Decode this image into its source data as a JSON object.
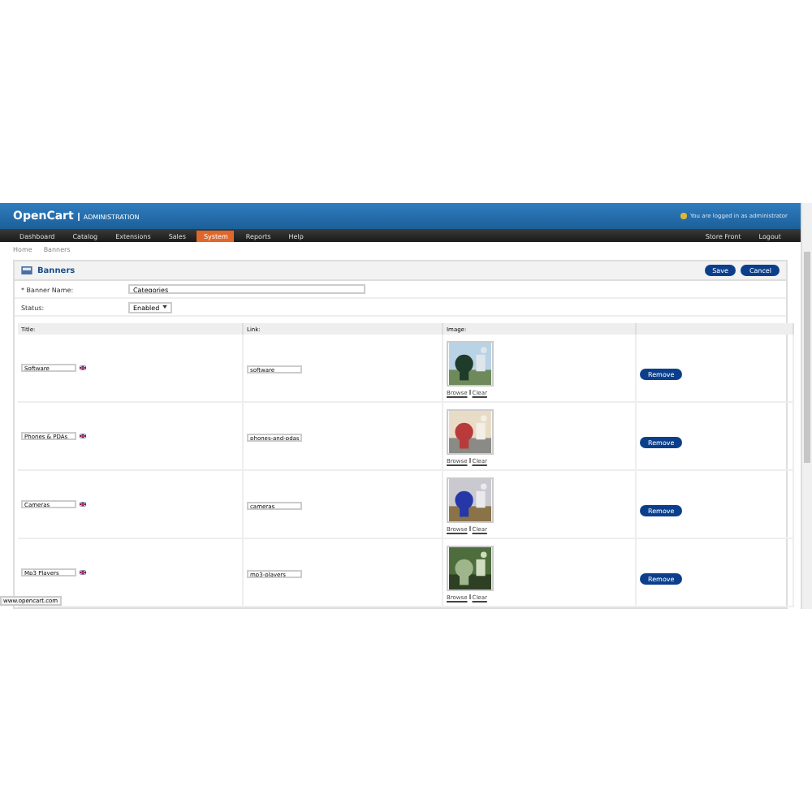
{
  "header": {
    "logo": "OpenCart",
    "subtitle": "ADMINISTRATION",
    "login_text": "You are logged in as administrator"
  },
  "nav": {
    "items": [
      {
        "label": "Dashboard",
        "selected": false
      },
      {
        "label": "Catalog",
        "selected": false
      },
      {
        "label": "Extensions",
        "selected": false
      },
      {
        "label": "Sales",
        "selected": false
      },
      {
        "label": "System",
        "selected": true
      },
      {
        "label": "Reports",
        "selected": false
      },
      {
        "label": "Help",
        "selected": false
      }
    ],
    "right": [
      "Store Front",
      "Logout"
    ]
  },
  "breadcrumb": [
    "Home",
    "Banners"
  ],
  "box": {
    "title": "Banners",
    "buttons": [
      "Save",
      "Cancel"
    ],
    "fields": [
      {
        "kind": "text",
        "label": "* Banner Name:",
        "value": "Categories"
      },
      {
        "kind": "select",
        "label": "Status:",
        "value": "Enabled"
      }
    ],
    "table": {
      "columns": [
        "Title:",
        "Link:",
        "Image:"
      ],
      "rows": [
        {
          "title": "Software",
          "link": "software",
          "browse": "Browse",
          "clear": "Clear",
          "remove": "Remove"
        },
        {
          "title": "Phones & PDAs",
          "link": "phones-and-pdas",
          "browse": "Browse",
          "clear": "Clear",
          "remove": "Remove"
        },
        {
          "title": "Cameras",
          "link": "cameras",
          "browse": "Browse",
          "clear": "Clear",
          "remove": "Remove"
        },
        {
          "title": "Mp3 Players",
          "link": "mp3-players",
          "browse": "Browse",
          "clear": "Clear",
          "remove": "Remove"
        }
      ]
    }
  },
  "status_bar": "www.opencart.com"
}
